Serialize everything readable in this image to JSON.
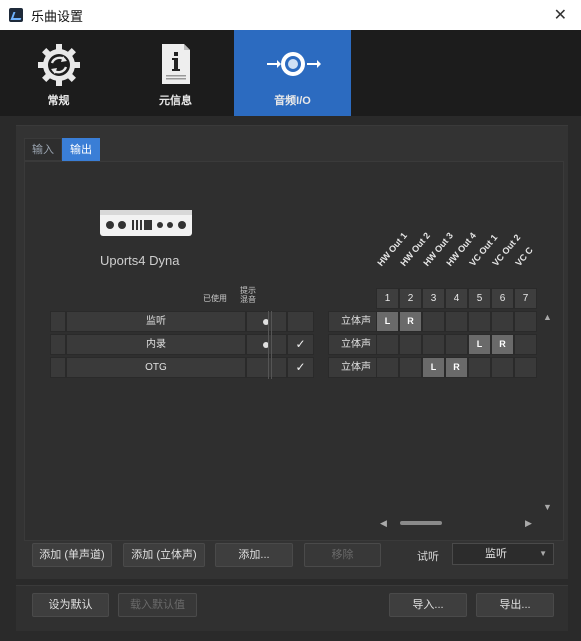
{
  "window": {
    "title": "乐曲设置",
    "close_icon": "close-icon"
  },
  "categories": [
    {
      "label": "常规",
      "icon": "gear-refresh-icon",
      "active": false
    },
    {
      "label": "元信息",
      "icon": "info-document-icon",
      "active": false
    },
    {
      "label": "音频I/O",
      "icon": "audio-io-icon",
      "active": true
    }
  ],
  "subtabs": [
    {
      "label": "输入",
      "active": false
    },
    {
      "label": "输出",
      "active": true
    }
  ],
  "device": {
    "name": "Uports4 Dyna",
    "icon": "audio-interface-icon"
  },
  "headers": {
    "used": "已使用",
    "mix": "提示混音"
  },
  "rows": [
    {
      "name": "监听",
      "used": true,
      "mix": false,
      "type": "立体声",
      "num": "1"
    },
    {
      "name": "内录",
      "used": true,
      "mix": true,
      "type": "立体声",
      "num": "2"
    },
    {
      "name": "OTG",
      "used": false,
      "mix": true,
      "type": "立体声",
      "num": "3*"
    }
  ],
  "matrix": {
    "columns": [
      {
        "label": "HW Out 1",
        "num": "1"
      },
      {
        "label": "HW Out 2",
        "num": "2"
      },
      {
        "label": "HW Out 3",
        "num": "3"
      },
      {
        "label": "HW Out 4",
        "num": "4"
      },
      {
        "label": "VC Out 1",
        "num": "5"
      },
      {
        "label": "VC Out 2",
        "num": "6"
      },
      {
        "label": "VC C",
        "num": "7"
      }
    ],
    "assignments": [
      {
        "row": 0,
        "col": 0,
        "text": "L"
      },
      {
        "row": 0,
        "col": 1,
        "text": "R"
      },
      {
        "row": 1,
        "col": 4,
        "text": "L"
      },
      {
        "row": 1,
        "col": 5,
        "text": "R"
      },
      {
        "row": 2,
        "col": 2,
        "text": "L"
      },
      {
        "row": 2,
        "col": 3,
        "text": "R"
      }
    ]
  },
  "buttons": {
    "add_mono": "添加 (单声道)",
    "add_stereo": "添加 (立体声)",
    "add": "添加...",
    "remove": "移除",
    "set_default": "设为默认",
    "load_default": "载入默认值",
    "import": "导入...",
    "export": "导出..."
  },
  "audition": {
    "label": "试听",
    "value": "监听"
  },
  "colors": {
    "accent": "#2c6bc0",
    "subtab_active": "#3a7ed6"
  }
}
